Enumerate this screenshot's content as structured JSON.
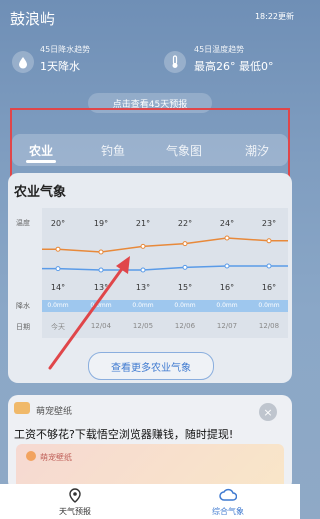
{
  "header": {
    "title": "鼓浪屿",
    "time": "18:22更新"
  },
  "trend_rain": {
    "subtitle": "45日降水趋势",
    "value": "1天降水"
  },
  "trend_temp": {
    "subtitle": "45日温度趋势",
    "value": "最高26° 最低0°"
  },
  "forecast_button": "点击查看45天预报",
  "tabs": [
    {
      "label": "农业"
    },
    {
      "label": "钓鱼"
    },
    {
      "label": "气象图"
    },
    {
      "label": "潮汐"
    }
  ],
  "agri": {
    "title": "农业气象",
    "row_labels": {
      "temp": "温度",
      "precip": "降水",
      "date": "日期"
    },
    "high": [
      "20°",
      "19°",
      "21°",
      "22°",
      "24°",
      "23°"
    ],
    "low": [
      "14°",
      "13°",
      "13°",
      "15°",
      "16°",
      "16°"
    ],
    "precip": [
      "0.0mm",
      "0.0mm",
      "0.0mm",
      "0.0mm",
      "0.0mm",
      "0.0mm"
    ],
    "dates": [
      "今天",
      "12/04",
      "12/05",
      "12/06",
      "12/07",
      "12/08"
    ],
    "more_button": "查看更多农业气象"
  },
  "chart_data": {
    "type": "line",
    "categories": [
      "今天",
      "12/04",
      "12/05",
      "12/06",
      "12/07",
      "12/08"
    ],
    "series": [
      {
        "values": [
          20,
          19,
          21,
          22,
          24,
          23
        ]
      },
      {
        "values": [
          14,
          13,
          13,
          15,
          16,
          16
        ]
      }
    ],
    "colors": [
      "#e8893a",
      "#5a9be8"
    ]
  },
  "ad": {
    "brand": "萌宠壁纸",
    "text": "工资不够花?下载悟空浏览器赚钱，随时提现!",
    "banner_text": "萌宠壁纸",
    "close": "×"
  },
  "nav": [
    {
      "label": "天气预报"
    },
    {
      "label": "综合气象"
    }
  ],
  "colors": {
    "accent": "#3f7ad0",
    "box": "#e0464a"
  }
}
